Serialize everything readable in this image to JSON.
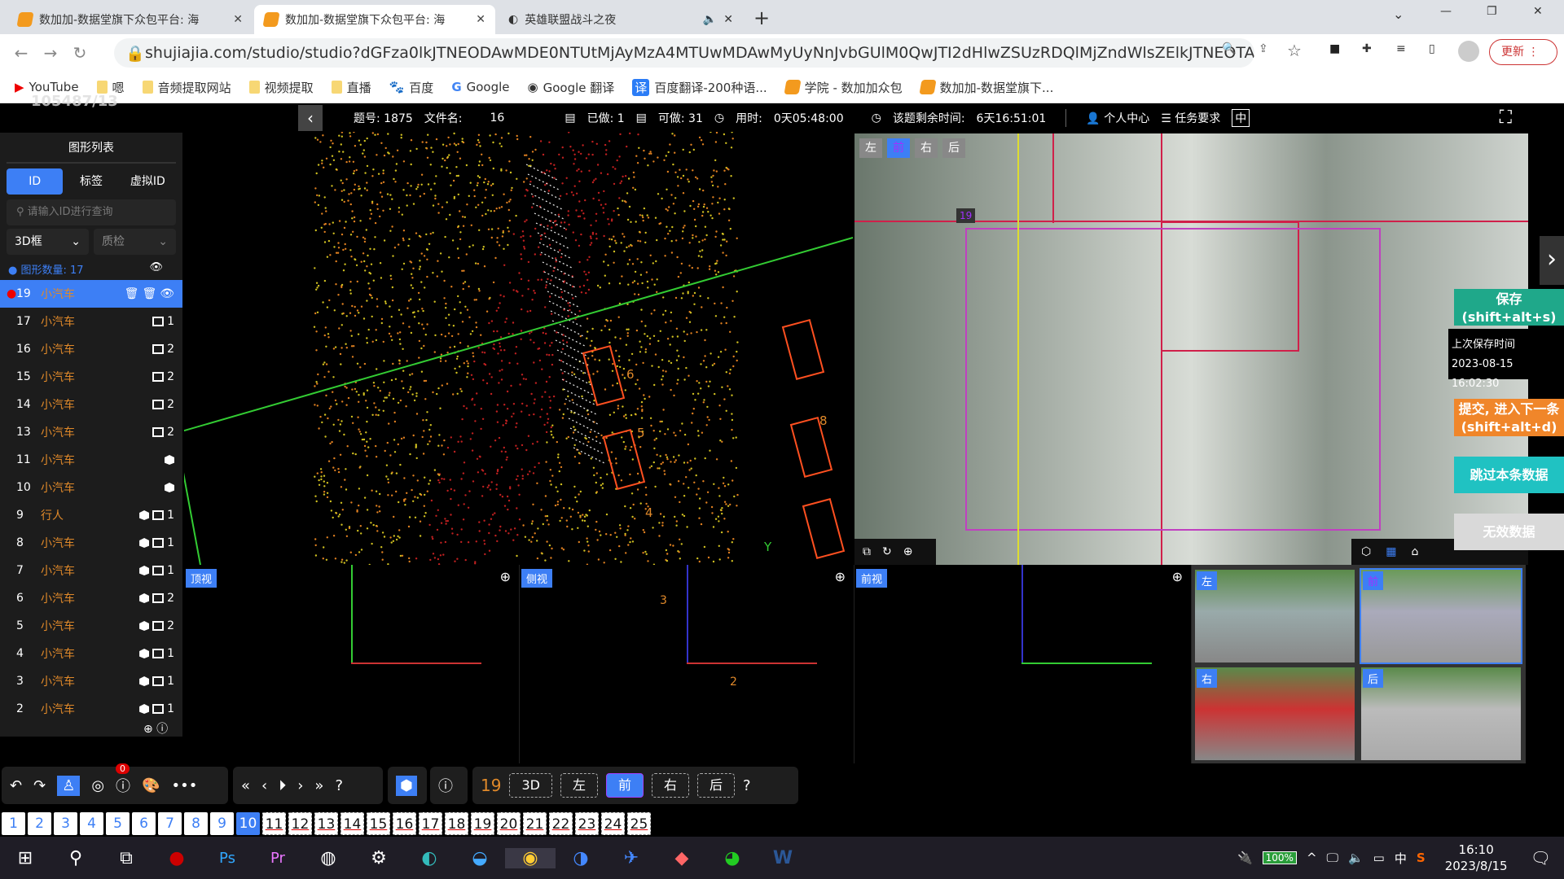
{
  "browser": {
    "tabs": [
      {
        "title": "数加加-数据堂旗下众包平台: 海",
        "active": false
      },
      {
        "title": "数加加-数据堂旗下众包平台: 海",
        "active": true
      },
      {
        "title": "英雄联盟战斗之夜",
        "active": false
      }
    ],
    "url": "shujiajia.com/studio/studio?dGFza0lkJTNEODAwMDE0NTUtMjAyMzA4MTUwMDAwMyUyNnJvbGUlM0QwJTI2dHlwZSUzRDQlMjZndWlsZElkJTNEOTAwMDI...",
    "update_label": "更新",
    "bookmarks": [
      "YouTube",
      "嗯",
      "音频提取网站",
      "视频提取",
      "直播",
      "百度",
      "Google",
      "Google 翻译",
      "百度翻译-200种语...",
      "学院 - 数加加众包",
      "数加加-数据堂旗下..."
    ],
    "watermark_id": "105487/13"
  },
  "topbar": {
    "question_no": "题号: 1875",
    "file_label": "文件名:",
    "file_value": "16",
    "done": "已做: 1",
    "available": "可做: 31",
    "time_used_label": "用时:",
    "time_used": "0天05:48:00",
    "remaining_label": "该题剩余时间:",
    "remaining": "6天16:51:01",
    "personal": "个人中心",
    "requirements": "任务要求",
    "lang": "中"
  },
  "sidebar": {
    "title": "图形列表",
    "tabs": [
      "ID",
      "标签",
      "虚拟ID"
    ],
    "search_placeholder": "请输入ID进行查询",
    "filter_type": "3D框",
    "filter_qc": "质检",
    "count_label": "图形数量:",
    "count": "17",
    "items": [
      {
        "id": "19",
        "label": "小汽车",
        "cube": false,
        "box": ""
      },
      {
        "id": "17",
        "label": "小汽车",
        "cube": false,
        "box": "1"
      },
      {
        "id": "16",
        "label": "小汽车",
        "cube": false,
        "box": "2"
      },
      {
        "id": "15",
        "label": "小汽车",
        "cube": false,
        "box": "2"
      },
      {
        "id": "14",
        "label": "小汽车",
        "cube": false,
        "box": "2"
      },
      {
        "id": "13",
        "label": "小汽车",
        "cube": false,
        "box": "2"
      },
      {
        "id": "11",
        "label": "小汽车",
        "cube": true,
        "box": ""
      },
      {
        "id": "10",
        "label": "小汽车",
        "cube": true,
        "box": ""
      },
      {
        "id": "9",
        "label": "行人",
        "cube": true,
        "box": "1"
      },
      {
        "id": "8",
        "label": "小汽车",
        "cube": true,
        "box": "1"
      },
      {
        "id": "7",
        "label": "小汽车",
        "cube": true,
        "box": "1"
      },
      {
        "id": "6",
        "label": "小汽车",
        "cube": true,
        "box": "2"
      },
      {
        "id": "5",
        "label": "小汽车",
        "cube": true,
        "box": "2"
      },
      {
        "id": "4",
        "label": "小汽车",
        "cube": true,
        "box": "1"
      },
      {
        "id": "3",
        "label": "小汽车",
        "cube": true,
        "box": "1"
      },
      {
        "id": "2",
        "label": "小汽车",
        "cube": true,
        "box": "1"
      }
    ]
  },
  "view3d": {
    "labels": [
      "6",
      "5",
      "4",
      "8"
    ],
    "axis_y": "Y"
  },
  "image_view": {
    "cams": [
      "左",
      "前",
      "右",
      "后"
    ],
    "active_cam": "前",
    "box_id": "19"
  },
  "side_actions": {
    "save": "保存",
    "save_key": "(shift+alt+s)",
    "last_save_label": "上次保存时间",
    "last_save": "2023-08-15 16:02:30",
    "submit": "提交, 进入下一条",
    "submit_key": "(shift+alt+d)",
    "skip": "跳过本条数据",
    "invalid": "无效数据"
  },
  "sub_views": [
    {
      "label": "顶视",
      "nums": []
    },
    {
      "label": "侧视",
      "nums": [
        "3",
        "2"
      ]
    },
    {
      "label": "前视",
      "nums": []
    }
  ],
  "thumbs": [
    "左",
    "前",
    "右",
    "后"
  ],
  "toolbar": {
    "badge": "0",
    "current_id": "19",
    "views": [
      "3D",
      "左",
      "前",
      "右",
      "后"
    ],
    "active_view": "前"
  },
  "pages": {
    "items": [
      "1",
      "2",
      "3",
      "4",
      "5",
      "6",
      "7",
      "8",
      "9",
      "10",
      "11",
      "12",
      "13",
      "14",
      "15",
      "16",
      "17",
      "18",
      "19",
      "20",
      "21",
      "22",
      "23",
      "24",
      "25"
    ],
    "current": "10"
  },
  "taskbar": {
    "battery": "100%",
    "ime": "中",
    "time": "16:10",
    "date": "2023/8/15"
  },
  "colors": {
    "accent": "#3d7ff5",
    "save": "#1fa88a",
    "submit": "#f0862a",
    "skip": "#20c2c2",
    "invalid": "#d9d9d9",
    "label": "#e0892a"
  }
}
